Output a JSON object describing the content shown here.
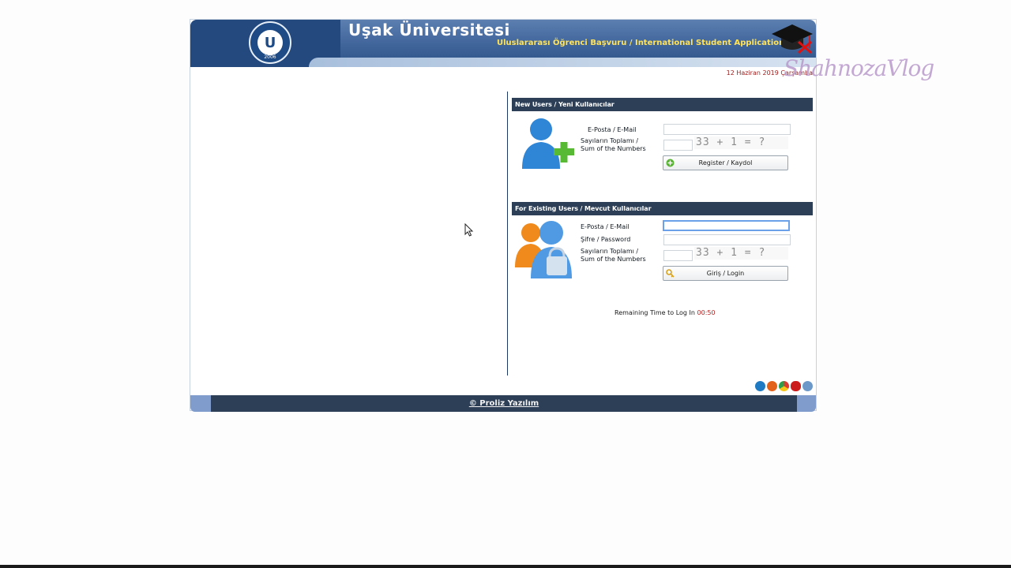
{
  "header": {
    "university_title": "Uşak Üniversitesi",
    "subtitle": "Uluslararası Öğrenci Başvuru / International Student Application",
    "logo_year": "2006",
    "logo_initials": "U"
  },
  "date": "12 Haziran 2019 Çarşamba",
  "new_users": {
    "heading": "New Users / Yeni Kullanıcılar",
    "email_label": "E-Posta / E-Mail",
    "email_value": "",
    "sum_label_line1": "Sayıların Toplamı /",
    "sum_label_line2": "Sum of the Numbers",
    "sum_value": "",
    "captcha_text": "33 + 1 = ?",
    "register_button": "Register / Kaydol",
    "icon": "add-user-icon"
  },
  "existing_users": {
    "heading": "For Existing Users / Mevcut Kullanıcılar",
    "email_label": "E-Posta / E-Mail",
    "email_value": "",
    "password_label": "Şifre / Password",
    "password_value": "",
    "sum_label_line1": "Sayıların Toplamı /",
    "sum_label_line2": "Sum of the Numbers",
    "sum_value": "",
    "captcha_text": "33 + 1 = ?",
    "login_button": "Giriş / Login",
    "icon": "users-lock-icon"
  },
  "remaining": {
    "label": "Remaining Time to Log In",
    "time": "00:50"
  },
  "footer": {
    "link": "© Proliz Yazılım"
  },
  "watermark": "ShahnozaVlog",
  "colors": {
    "header_blue": "#3f649a",
    "panel_head": "#2c3f57",
    "subtitle_yellow": "#ffe35a",
    "date_red": "#9b1c1c",
    "timer_red": "#b21f1f"
  }
}
